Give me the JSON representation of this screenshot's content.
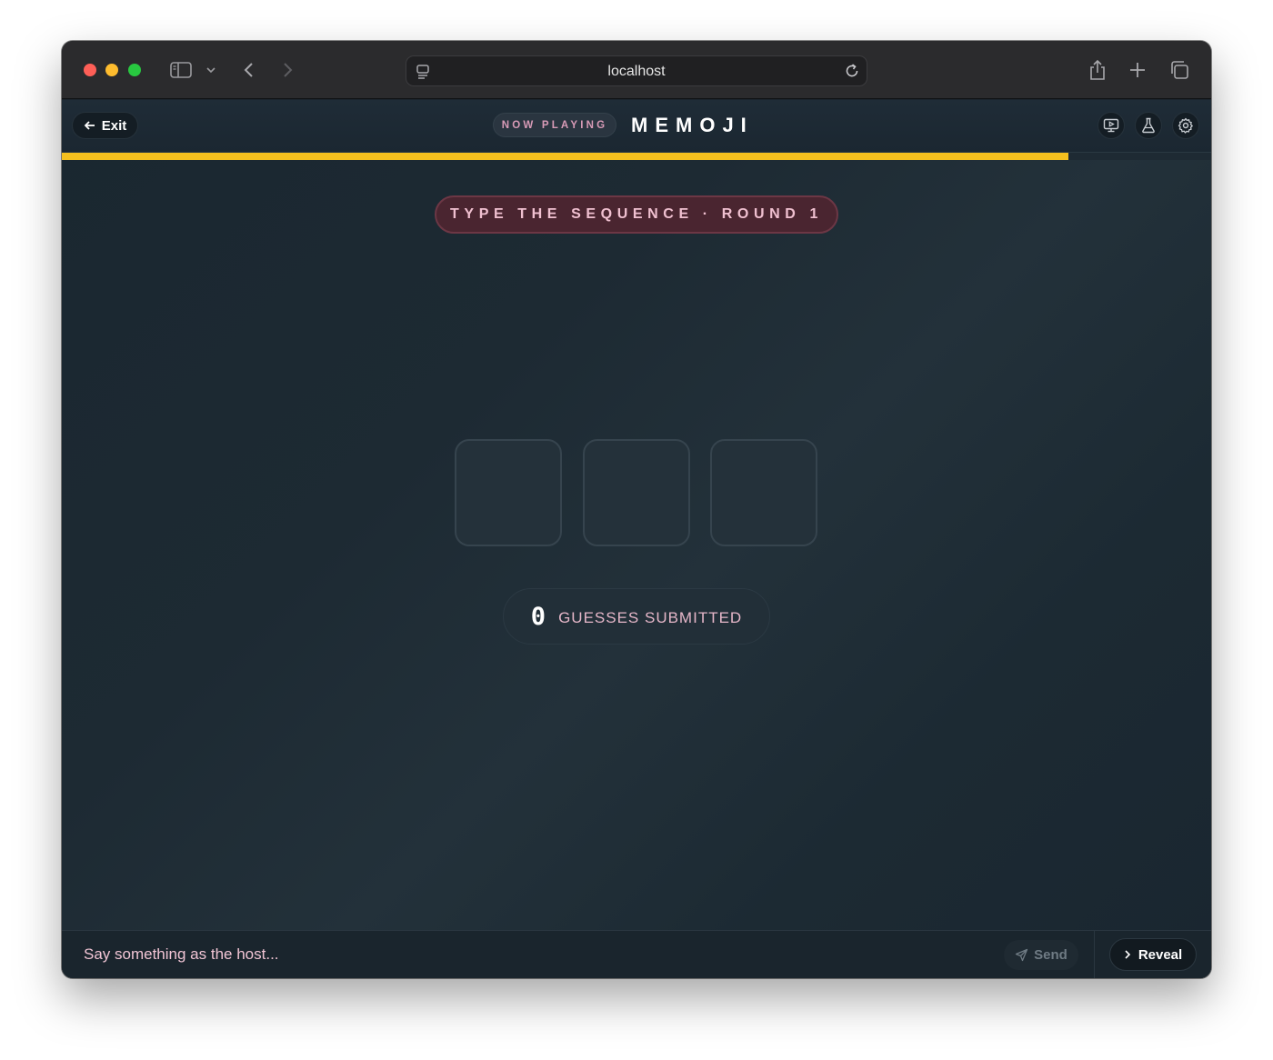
{
  "browser": {
    "url": "localhost",
    "icons": [
      "sidebar-icon",
      "chevron-down-icon",
      "back-icon",
      "forward-icon",
      "site-icon",
      "reload-icon",
      "share-icon",
      "new-tab-icon",
      "tabs-overview-icon"
    ]
  },
  "header": {
    "exit_label": "Exit",
    "now_playing_label": "NOW PLAYING",
    "game_title": "MEMOJI",
    "icons": [
      "screen-icon",
      "flask-icon",
      "gear-icon"
    ]
  },
  "progress": {
    "fraction": 0.876,
    "color": "#f5c01e"
  },
  "round": {
    "label": "TYPE THE SEQUENCE · ROUND 1"
  },
  "sequence": {
    "slots": [
      "",
      "",
      ""
    ]
  },
  "guesses": {
    "count": "0",
    "label": "GUESSES SUBMITTED"
  },
  "footer": {
    "input_placeholder": "Say something as the host...",
    "send_label": "Send",
    "reveal_label": "Reveal"
  },
  "colors": {
    "accent": "#f5c01e",
    "pink_text": "#f0c0d0",
    "round_pill_bg": "#4a2530"
  }
}
